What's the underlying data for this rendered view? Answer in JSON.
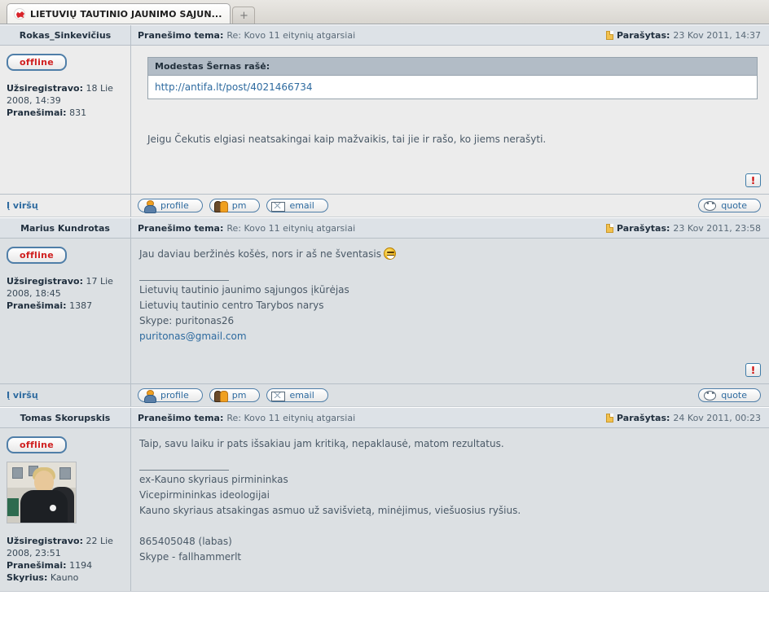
{
  "browser": {
    "tab_title": "LIETUVIŲ TAUTINIO JAUNIMO SĄJUN...",
    "favicon_name": "forum-favicon",
    "new_tab_label": "+"
  },
  "labels": {
    "topic_label": "Pranešimo tema:",
    "posted_label": "Parašytas:",
    "registered_label": "Užsiregistravo:",
    "posts_label": "Pranešimai:",
    "branch_label": "Skyrius:",
    "top_link": "Į viršų",
    "status_offline": "offline",
    "report_mark": "!"
  },
  "buttons": {
    "profile": "profile",
    "pm": "pm",
    "email": "email",
    "quote": "quote"
  },
  "colors": {
    "link": "#2d6a9f",
    "offline_text": "#d02020",
    "header_bg": "#dde2e7",
    "row_a_bg": "#ececec",
    "row_b_bg": "#dce0e3",
    "quote_head_bg": "#b2bcc6"
  },
  "posts": [
    {
      "author": "Rokas_Sinkevičius",
      "topic": "Re: Kovo 11 eitynių atgarsiai",
      "date": "23 Kov 2011, 14:37",
      "registered": "18 Lie 2008, 14:39",
      "post_count": "831",
      "branch": null,
      "has_avatar": false,
      "quote": {
        "header": "Modestas Šernas rašė:",
        "link_text": "http://antifa.lt/post/4021466734"
      },
      "body_lines": [
        "Jeigu Čekutis elgiasi neatsakingai kaip mažvaikis, tai jie ir rašo, ko jiems nerašyti."
      ],
      "signature": [],
      "signature_email": null,
      "smiley": false
    },
    {
      "author": "Marius Kundrotas",
      "topic": "Re: Kovo 11 eitynių atgarsiai",
      "date": "23 Kov 2011, 23:58",
      "registered": "17 Lie 2008, 18:45",
      "post_count": "1387",
      "branch": null,
      "has_avatar": false,
      "quote": null,
      "body_lines": [
        "Jau daviau beržinės košės, nors ir aš ne šventasis"
      ],
      "signature": [
        "Lietuvių tautinio jaunimo sąjungos įkūrėjas",
        "Lietuvių tautinio centro Tarybos narys",
        "Skype: puritonas26"
      ],
      "signature_email": "puritonas@gmail.com",
      "smiley": true
    },
    {
      "author": "Tomas Skorupskis",
      "topic": "Re: Kovo 11 eitynių atgarsiai",
      "date": "24 Kov 2011, 00:23",
      "registered": "22 Lie 2008, 23:51",
      "post_count": "1194",
      "branch": "Kauno",
      "has_avatar": true,
      "quote": null,
      "body_lines": [
        "Taip, savu laiku ir pats išsakiau jam kritiką, nepaklausė, matom rezultatus."
      ],
      "signature": [
        "ex-Kauno skyriaus pirmininkas",
        "Vicepirmininkas ideologijai",
        "Kauno skyriaus atsakingas asmuo už savišvietą, minėjimus, viešuosius ryšius.",
        "",
        "865405048 (labas)",
        "Skype - fallhammerlt"
      ],
      "signature_email": null,
      "smiley": false
    }
  ]
}
